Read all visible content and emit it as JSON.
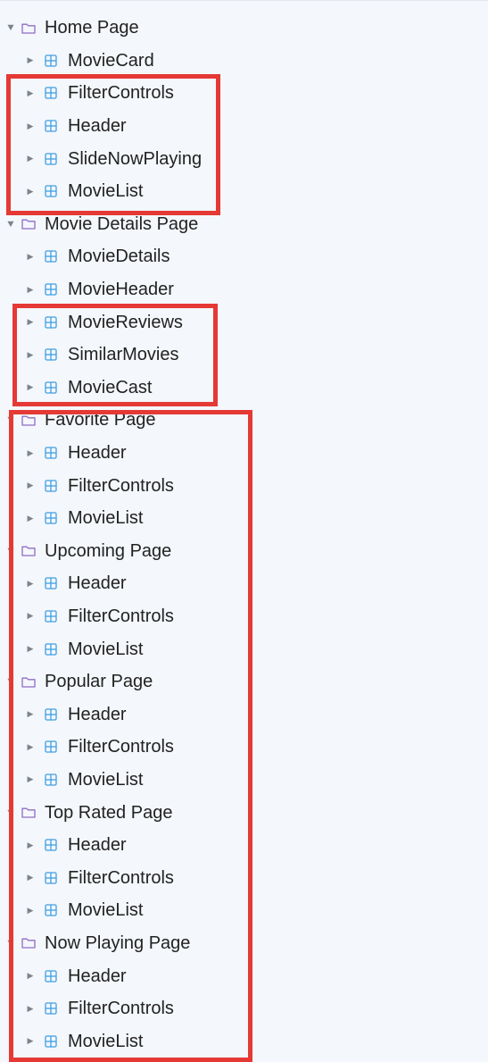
{
  "colors": {
    "background": "#f4f7fb",
    "folder_icon": "#8e6cc8",
    "component_icon": "#3f9fe3",
    "caret": "#7d838c",
    "highlight_border": "#e53935"
  },
  "icons": {
    "expanded": "caret-down-icon",
    "collapsed": "caret-right-icon",
    "page": "folder-icon",
    "component": "component-grid-icon"
  },
  "tree": [
    {
      "label": "Home Page",
      "children": [
        "MovieCard",
        "FilterControls",
        "Header",
        "SlideNowPlaying",
        "MovieList"
      ]
    },
    {
      "label": "Movie Details Page",
      "children": [
        "MovieDetails",
        "MovieHeader",
        "MovieReviews",
        "SimilarMovies",
        "MovieCast"
      ]
    },
    {
      "label": "Favorite Page",
      "children": [
        "Header",
        "FilterControls",
        "MovieList"
      ]
    },
    {
      "label": "Upcoming Page",
      "children": [
        "Header",
        "FilterControls",
        "MovieList"
      ]
    },
    {
      "label": "Popular Page",
      "children": [
        "Header",
        "FilterControls",
        "MovieList"
      ]
    },
    {
      "label": "Top Rated Page",
      "children": [
        "Header",
        "FilterControls",
        "MovieList"
      ]
    },
    {
      "label": "Now Playing Page",
      "children": [
        "Header",
        "FilterControls",
        "MovieList"
      ]
    }
  ]
}
